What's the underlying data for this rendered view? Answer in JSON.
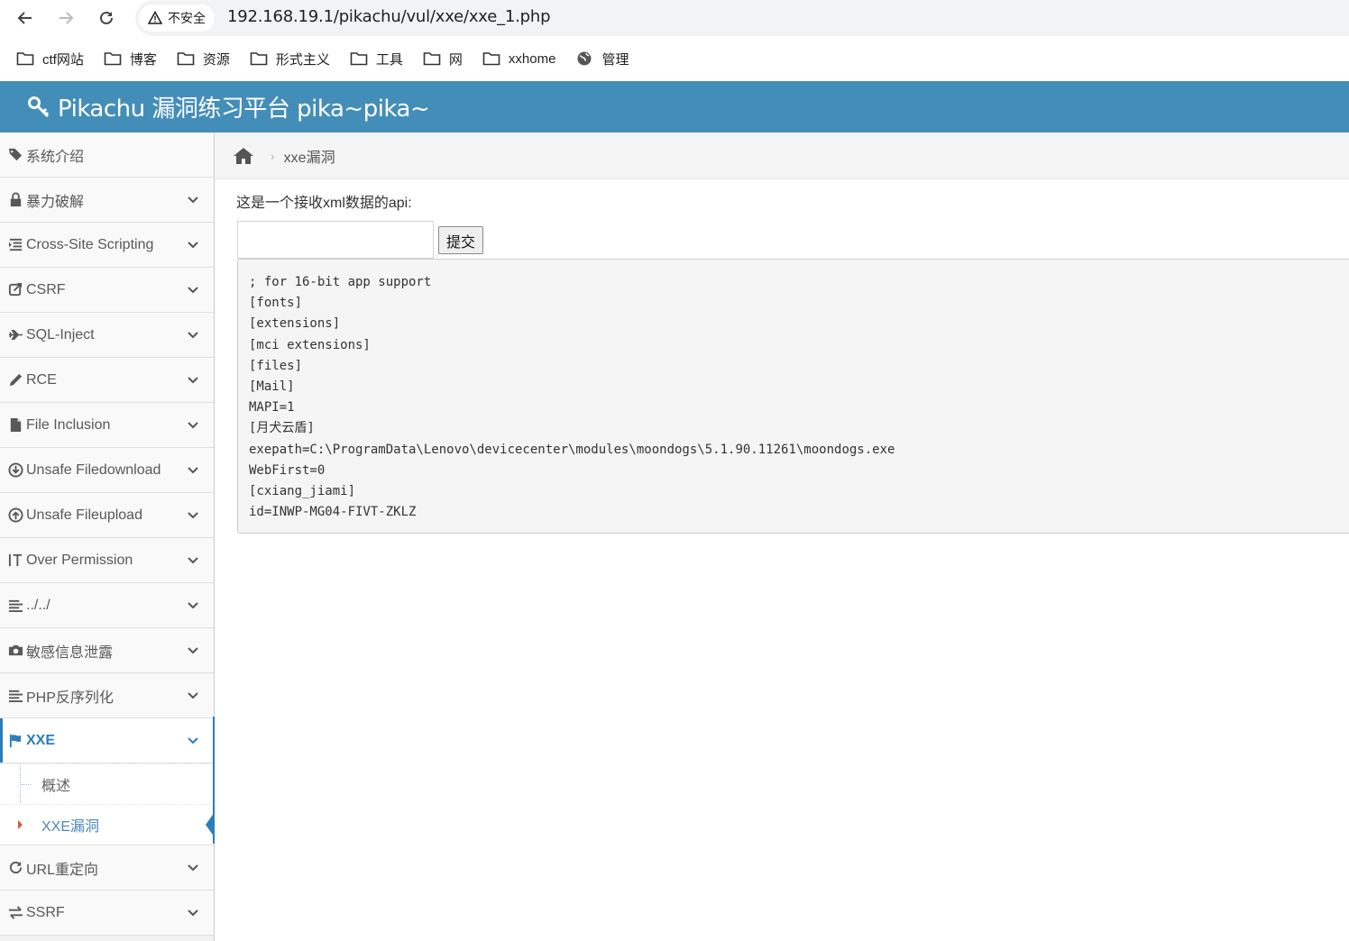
{
  "browser": {
    "security_label": "不安全",
    "url": "192.168.19.1/pikachu/vul/xxe/xxe_1.php",
    "bookmarks": [
      {
        "label": "ctf网站",
        "icon": "folder-icon"
      },
      {
        "label": "博客",
        "icon": "folder-icon"
      },
      {
        "label": "资源",
        "icon": "folder-icon"
      },
      {
        "label": "形式主义",
        "icon": "folder-icon"
      },
      {
        "label": "工具",
        "icon": "folder-icon"
      },
      {
        "label": "网",
        "icon": "folder-icon"
      },
      {
        "label": "xxhome",
        "icon": "folder-icon"
      },
      {
        "label": "管理",
        "icon": "globe-icon"
      }
    ]
  },
  "header": {
    "title": "Pikachu 漏洞练习平台 pika~pika~",
    "icon": "key-icon"
  },
  "sidebar": {
    "items": [
      {
        "label": "系统介绍",
        "icon": "tags-icon"
      },
      {
        "label": "暴力破解",
        "icon": "lock-icon"
      },
      {
        "label": "Cross-Site Scripting",
        "icon": "indent-icon"
      },
      {
        "label": "CSRF",
        "icon": "share-icon"
      },
      {
        "label": "SQL-Inject",
        "icon": "plane-icon"
      },
      {
        "label": "RCE",
        "icon": "pencil-icon"
      },
      {
        "label": "File Inclusion",
        "icon": "file-icon"
      },
      {
        "label": "Unsafe Filedownload",
        "icon": "download-icon"
      },
      {
        "label": "Unsafe Fileupload",
        "icon": "upload-icon"
      },
      {
        "label": "Over Permission",
        "icon": "text-height-icon"
      },
      {
        "label": "../../",
        "icon": "align-left-icon"
      },
      {
        "label": "敏感信息泄露",
        "icon": "camera-icon"
      },
      {
        "label": "PHP反序列化",
        "icon": "align-left-icon"
      },
      {
        "label": "XXE",
        "icon": "flag-icon"
      },
      {
        "label": "URL重定向",
        "icon": "refresh-icon"
      },
      {
        "label": "SSRF",
        "icon": "exchange-icon"
      }
    ],
    "xxe_sub": [
      "概述",
      "XXE漏洞"
    ]
  },
  "breadcrumb": {
    "current": "xxe漏洞"
  },
  "main": {
    "intro": "这是一个接收xml数据的api:",
    "input_value": "",
    "submit_label": "提交",
    "output_lines": [
      "; for 16-bit app support",
      "[fonts]",
      "[extensions]",
      "[mci extensions]",
      "[files]",
      "[Mail]",
      "MAPI=1",
      "[月犬云盾]",
      "exepath=C:\\ProgramData\\Lenovo\\devicecenter\\modules\\moondogs\\5.1.90.11261\\moondogs.exe",
      "WebFirst=0",
      "[cxiang_jiami]",
      "id=INWP-MG04-FIVT-ZKLZ"
    ]
  },
  "colors": {
    "header_bg": "#438eb9",
    "active_blue": "#2b7dbc"
  }
}
